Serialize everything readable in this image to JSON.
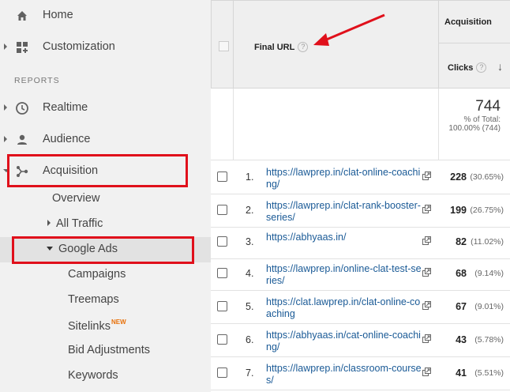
{
  "sidebar": {
    "home": "Home",
    "customization": "Customization",
    "reports_heading": "REPORTS",
    "realtime": "Realtime",
    "audience": "Audience",
    "acquisition": "Acquisition",
    "overview": "Overview",
    "all_traffic": "All Traffic",
    "google_ads": "Google Ads",
    "campaigns": "Campaigns",
    "treemaps": "Treemaps",
    "sitelinks": "Sitelinks",
    "new_badge": "NEW",
    "bid_adjustments": "Bid Adjustments",
    "keywords": "Keywords"
  },
  "table": {
    "final_url_header": "Final URL",
    "help_glyph": "?",
    "acquisition_header": "Acquisition",
    "clicks_header": "Clicks",
    "sort_glyph": "↓",
    "total_clicks": "744",
    "total_line1": "% of Total:",
    "total_line2": "100.00% (744)",
    "rows": [
      {
        "num": "1.",
        "url": "https://lawprep.in/clat-online-coaching/",
        "clicks": "228",
        "pct": "(30.65%)"
      },
      {
        "num": "2.",
        "url": "https://lawprep.in/clat-rank-booster-series/",
        "clicks": "199",
        "pct": "(26.75%)"
      },
      {
        "num": "3.",
        "url": "https://abhyaas.in/",
        "clicks": "82",
        "pct": "(11.02%)"
      },
      {
        "num": "4.",
        "url": "https://lawprep.in/online-clat-test-series/",
        "clicks": "68",
        "pct": "(9.14%)"
      },
      {
        "num": "5.",
        "url": "https://clat.lawprep.in/clat-online-coaching",
        "clicks": "67",
        "pct": "(9.01%)"
      },
      {
        "num": "6.",
        "url": "https://abhyaas.in/cat-online-coaching/",
        "clicks": "43",
        "pct": "(5.78%)"
      },
      {
        "num": "7.",
        "url": "https://lawprep.in/classroom-courses/",
        "clicks": "41",
        "pct": "(5.51%)"
      }
    ]
  },
  "colors": {
    "highlight_box": "#e0101b",
    "link": "#1a5a96",
    "sidebar_bg": "#f1f1f1"
  }
}
